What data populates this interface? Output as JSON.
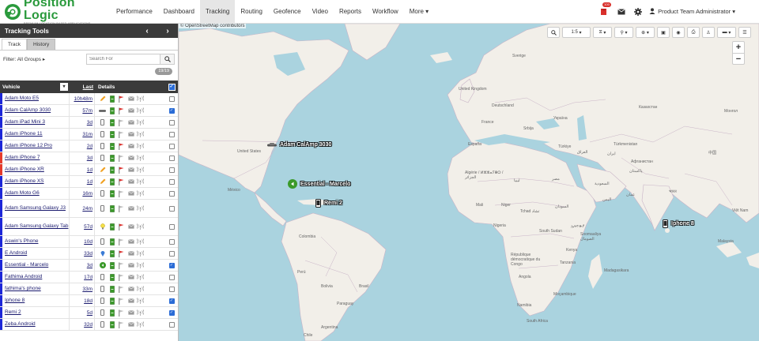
{
  "brand": {
    "name": "Position Logic",
    "tagline": "PREMIUM LOCATION-BASED APPLICATIONS",
    "color": "#2a9a3c"
  },
  "nav": {
    "items": [
      "Performance",
      "Dashboard",
      "Tracking",
      "Routing",
      "Geofence",
      "Video",
      "Reports",
      "Workflow",
      "More ▾"
    ],
    "active": "Tracking",
    "alert_badge": "100",
    "user": "Product Team Administrator ▾"
  },
  "sidebar": {
    "title": "Tracking Tools",
    "prev": "‹",
    "next": "›",
    "tabs": [
      "Track",
      "History"
    ],
    "filter_label": "Filter: All Groups ▸",
    "search_placeholder": "Search For",
    "count": "19/19",
    "columns": {
      "vehicle": "Vehicle",
      "last": "Last",
      "details": "Details"
    },
    "vehicles": [
      {
        "name": "Adam Moto E5",
        "last": "10h48m",
        "checked": false,
        "bar": "blue",
        "device": "pencil",
        "flag": "red"
      },
      {
        "name": "Adam CalAmp 3030",
        "last": "57m",
        "checked": true,
        "bar": "blue",
        "device": "car",
        "flag": "red"
      },
      {
        "name": "Adam iPad Mini 3",
        "last": "3d",
        "checked": false,
        "bar": "blue",
        "device": "phone",
        "flag": "gray"
      },
      {
        "name": "Adam iPhone 11",
        "last": "31m",
        "checked": false,
        "bar": "blue",
        "device": "phone",
        "flag": "gray"
      },
      {
        "name": "Adam iPhone 12 Pro",
        "last": "2d",
        "checked": false,
        "bar": "blue",
        "device": "phone",
        "flag": "red"
      },
      {
        "name": "Adam iPhone 7",
        "last": "3d",
        "checked": false,
        "bar": "red",
        "device": "phone",
        "flag": "gray"
      },
      {
        "name": "Adam iPhone XR",
        "last": "1d",
        "checked": false,
        "bar": "red",
        "device": "pencil",
        "flag": "red"
      },
      {
        "name": "Adam iPhone XS",
        "last": "1d",
        "checked": false,
        "bar": "blue",
        "device": "pencil",
        "flag": "red"
      },
      {
        "name": "Adam Moto G6",
        "last": "16m",
        "checked": false,
        "bar": "blue",
        "device": "phone",
        "flag": "gray"
      },
      {
        "name": "Adam Samsung Galaxy J3",
        "last": "24m",
        "checked": false,
        "bar": "blue",
        "device": "phone",
        "flag": "gray"
      },
      {
        "name": "Adam Samsung Galaxy Tab",
        "last": "57d",
        "checked": false,
        "bar": "blue",
        "device": "bulb",
        "flag": "red"
      },
      {
        "name": "Aswin's Phone",
        "last": "10d",
        "checked": false,
        "bar": "blue",
        "device": "phone",
        "flag": "gray"
      },
      {
        "name": "E Android",
        "last": "33d",
        "checked": false,
        "bar": "blue",
        "device": "pin",
        "flag": "red"
      },
      {
        "name": "Essential - Marcelo",
        "last": "3d",
        "checked": true,
        "bar": "blue",
        "device": "play",
        "flag": "gray"
      },
      {
        "name": "Fathima Android",
        "last": "17d",
        "checked": false,
        "bar": "blue",
        "device": "phone",
        "flag": "gray"
      },
      {
        "name": "fathima's phone",
        "last": "33m",
        "checked": false,
        "bar": "blue",
        "device": "phone",
        "flag": "gray"
      },
      {
        "name": "Iphone 8",
        "last": "18d",
        "checked": true,
        "bar": "blue",
        "device": "phone",
        "flag": "gray"
      },
      {
        "name": "Remi 2",
        "last": "5d",
        "checked": true,
        "bar": "blue",
        "device": "phone",
        "flag": "gray"
      },
      {
        "name": "Zeba Android",
        "last": "32d",
        "checked": false,
        "bar": "blue",
        "device": "phone",
        "flag": "gray"
      }
    ]
  },
  "map": {
    "attribution": "© OpenStreetMap contributors",
    "zoom_select": "1:5",
    "markers": [
      {
        "label": "Adam CalAmp 3030",
        "type": "car"
      },
      {
        "label": "Essential - Marcelo",
        "type": "play"
      },
      {
        "label": "Remi 2",
        "type": "phone"
      },
      {
        "label": "Iphone 8",
        "type": "phone"
      }
    ],
    "places": [
      "Sverige",
      "United Kingdom",
      "Deutschland",
      "France",
      "España",
      "Türkiye",
      "ایران",
      "Казахстан",
      "Монгол",
      "United States",
      "México",
      "Colombia",
      "Perú",
      "Brasil",
      "Bolivia",
      "Paraguay",
      "Argentina",
      "Chile",
      "Algérie / ⵍⵣⵣⴰⵢⴻⵔ / الجزائر",
      "ليبيا",
      "مصر",
      "Mali",
      "Niger",
      "Tchad تشاد",
      "السودان",
      "Nigeria",
      "South Sudan",
      "ኢትዮጵያ",
      "Soomaaliya الصومال",
      "Kenya",
      "République démocratique du Congo",
      "Tanzania",
      "Angola",
      "Namibia",
      "Moçambique",
      "South Africa",
      "السعودية",
      "اليمن",
      "عمان",
      "Україна",
      "Türkmenistan",
      "پاکستان",
      "भारत",
      "中国",
      "Việt Nam",
      "Malaysia",
      "Madagasikara",
      "العراق",
      "Srbija",
      "Афганистан"
    ]
  }
}
